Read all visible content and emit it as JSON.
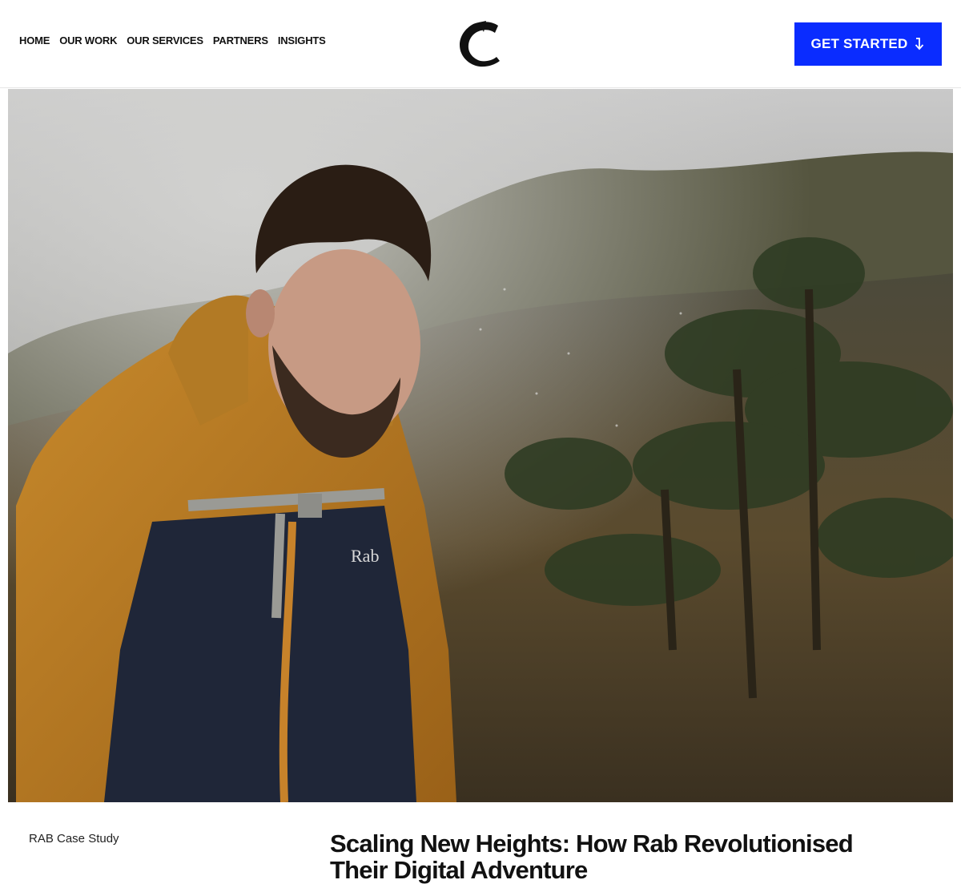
{
  "nav": {
    "items": [
      "HOME",
      "OUR WORK",
      "OUR SERVICES",
      "PARTNERS",
      "INSIGHTS"
    ]
  },
  "logo": {
    "icon": "c-letter-logo-icon"
  },
  "cta": {
    "label": "GET STARTED",
    "icon": "arrow-down-icon",
    "color": "#0a2cff"
  },
  "hero": {
    "alt": "Hiker in an orange and navy Rab jacket walking through a misty forest",
    "jacket_logo": "Rab"
  },
  "article": {
    "category": "RAB Case Study",
    "title_line1": "Scaling New Heights: How Rab Revolutionised",
    "title_line2": "Their Digital Adventure"
  }
}
